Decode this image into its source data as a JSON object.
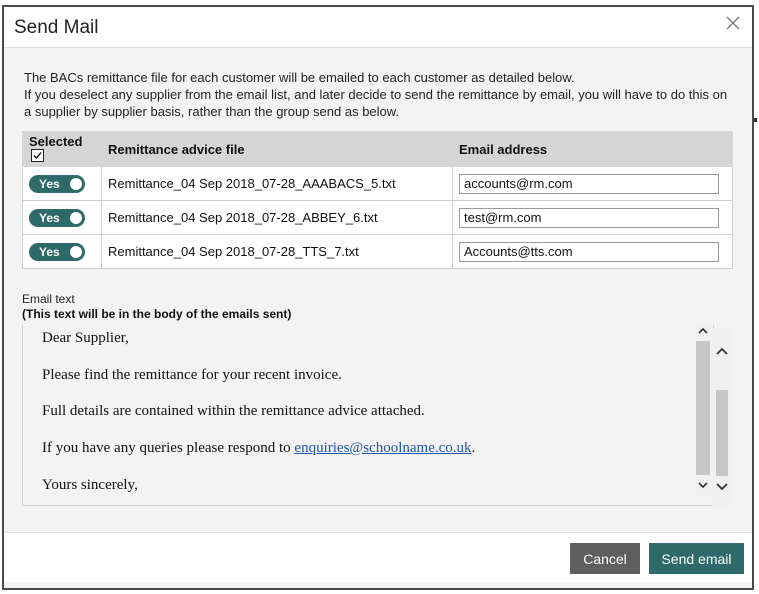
{
  "dialog": {
    "title": "Send Mail",
    "intro_lines": [
      "The BACs remittance file for each customer will be emailed to each customer as detailed below.",
      "If you deselect any supplier from the email list, and later decide to send the remittance by email, you will have to do this on",
      "a supplier by supplier basis, rather than the group send as below."
    ]
  },
  "table": {
    "headers": {
      "selected": "Selected",
      "file": "Remittance advice file",
      "email": "Email address"
    },
    "rows": [
      {
        "toggle": "Yes",
        "file": "Remittance_04 Sep 2018_07-28_AAABACS_5.txt",
        "email": "accounts@rm.com"
      },
      {
        "toggle": "Yes",
        "file": "Remittance_04 Sep 2018_07-28_ABBEY_6.txt",
        "email": "test@rm.com"
      },
      {
        "toggle": "Yes",
        "file": "Remittance_04 Sep 2018_07-28_TTS_7.txt",
        "email": "Accounts@tts.com"
      }
    ]
  },
  "email_text": {
    "label": "Email text",
    "note": "(This text will be in the body of the emails sent)",
    "greeting": "Dear Supplier,",
    "line1": "Please find the remittance for your recent invoice.",
    "line2": "Full details are contained within the remittance advice attached.",
    "line3_prefix": "If you have any queries please respond to ",
    "line3_link": "enquiries@schoolname.co.uk",
    "line3_suffix": ".",
    "closing": "Yours sincerely,"
  },
  "footer": {
    "cancel_label": "Cancel",
    "send_label": "Send email"
  },
  "colors": {
    "accent": "#2e6a6a",
    "cancel": "#5e5e5e"
  }
}
